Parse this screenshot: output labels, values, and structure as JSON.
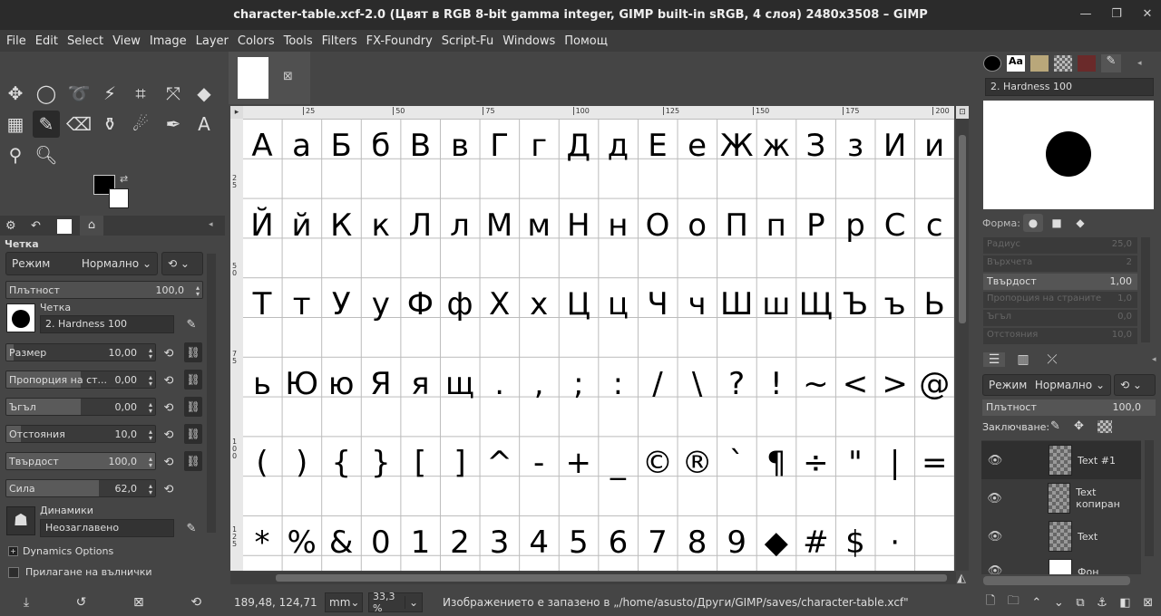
{
  "window": {
    "title": "character-table.xcf-2.0 (Цвят в RGB 8-bit gamma integer, GIMP built-in sRGB, 4 слоя) 2480x3508 – GIMP"
  },
  "menu": [
    "File",
    "Edit",
    "Select",
    "View",
    "Image",
    "Layer",
    "Colors",
    "Tools",
    "Filters",
    "FX-Foundry",
    "Script-Fu",
    "Windows",
    "Помощ"
  ],
  "tool_options": {
    "header": "Четка",
    "mode_label": "Режим",
    "mode_value": "Нормално",
    "opacity_label": "Плътност",
    "opacity_value": "100,0",
    "brush_label": "Четка",
    "brush_name": "2. Hardness 100",
    "sliders": [
      {
        "label": "Размер",
        "value": "10,00",
        "fill": 0.05
      },
      {
        "label": "Пропорция на ст...",
        "value": "0,00",
        "fill": 0.5
      },
      {
        "label": "Ъгъл",
        "value": "0,00",
        "fill": 0.5
      },
      {
        "label": "Отстояния",
        "value": "10,0",
        "fill": 0.1
      },
      {
        "label": "Твърдост",
        "value": "100,0",
        "fill": 1.0
      },
      {
        "label": "Сила",
        "value": "62,0",
        "fill": 0.62
      }
    ],
    "dynamics_label": "Динамики",
    "dynamics_value": "Неозаглавено",
    "dynamics_options": "Dynamics Options",
    "jitter_label": "Прилагане на вълнички"
  },
  "canvas": {
    "rows": [
      [
        "А",
        "а",
        "Б",
        "б",
        "В",
        "в",
        "Г",
        "г",
        "Д",
        "д",
        "Е",
        "е",
        "Ж",
        "ж",
        "З",
        "з",
        "И",
        "и"
      ],
      [
        "Й",
        "й",
        "К",
        "к",
        "Л",
        "л",
        "М",
        "м",
        "Н",
        "н",
        "О",
        "о",
        "П",
        "п",
        "Р",
        "р",
        "С",
        "с"
      ],
      [
        "Т",
        "т",
        "У",
        "у",
        "Ф",
        "ф",
        "Х",
        "х",
        "Ц",
        "ц",
        "Ч",
        "ч",
        "Ш",
        "ш",
        "Щ",
        "Ъ",
        "ъ",
        "Ь"
      ],
      [
        "ь",
        "Ю",
        "ю",
        "Я",
        "я",
        "щ",
        ".",
        ",",
        ";",
        ":",
        "/",
        "\\",
        "?",
        "!",
        "~",
        "<",
        ">",
        "@"
      ],
      [
        "(",
        ")",
        "{",
        "}",
        "[",
        "]",
        "^",
        "-",
        "+",
        "_",
        "©",
        "®",
        "`",
        "¶",
        "÷",
        "\"",
        "|",
        "="
      ],
      [
        "*",
        "%",
        "&",
        "0",
        "1",
        "2",
        "3",
        "4",
        "5",
        "6",
        "7",
        "8",
        "9",
        "◆",
        "#",
        "$",
        "·",
        ""
      ]
    ],
    "ruler_top": [
      "25",
      "50",
      "75",
      "100",
      "125",
      "150",
      "175",
      "200"
    ],
    "ruler_left": [
      "25",
      "50",
      "75",
      "100",
      "125"
    ]
  },
  "status": {
    "coords": "189,48, 124,71",
    "unit": "mm",
    "zoom": "33,3 %",
    "message": "Изображението е запазено в „/home/asusto/Други/GIMP/saves/character-table.xcf\""
  },
  "brushes_panel": {
    "brush_name": "2. Hardness 100",
    "shape_label": "Форма:",
    "rows": [
      {
        "label": "Радиус",
        "value": "25,0",
        "faded": true
      },
      {
        "label": "Върхчета",
        "value": "2",
        "faded": true
      },
      {
        "label": "Твърдост",
        "value": "1,00",
        "faded": false
      },
      {
        "label": "Пропорция на страните",
        "value": "1,0",
        "faded": true
      },
      {
        "label": "Ъгъл",
        "value": "0,0",
        "faded": true
      },
      {
        "label": "Отстояния",
        "value": "10,0",
        "faded": true
      }
    ]
  },
  "layers_panel": {
    "mode_label": "Режим",
    "mode_value": "Нормално",
    "opacity_label": "Плътност",
    "opacity_value": "100,0",
    "lock_label": "Заключване:",
    "layers": [
      "Text #1",
      "Text копиран",
      "Text",
      "Фон"
    ]
  }
}
